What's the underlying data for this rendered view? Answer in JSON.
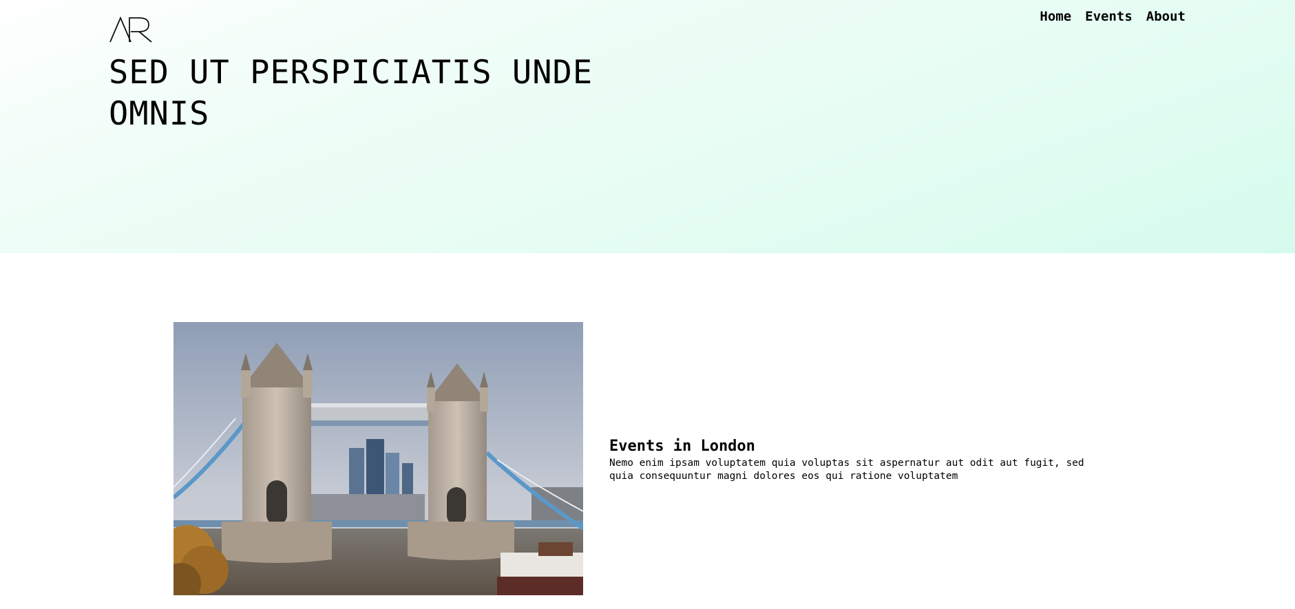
{
  "header": {
    "logo_text": "AR",
    "nav": [
      {
        "label": "Home"
      },
      {
        "label": "Events"
      },
      {
        "label": "About"
      }
    ]
  },
  "hero": {
    "title": "SED UT PERSPICIATIS UNDE OMNIS"
  },
  "event": {
    "image_icon": "tower-bridge-photo",
    "title": "Events in London",
    "description": "Nemo enim ipsam voluptatem quia voluptas sit aspernatur aut odit aut fugit, sed quia consequuntur magni dolores eos qui ratione voluptatem"
  },
  "colors": {
    "hero_gradient_start": "#ffffff",
    "hero_gradient_end": "#d6fbee",
    "text": "#000000"
  }
}
